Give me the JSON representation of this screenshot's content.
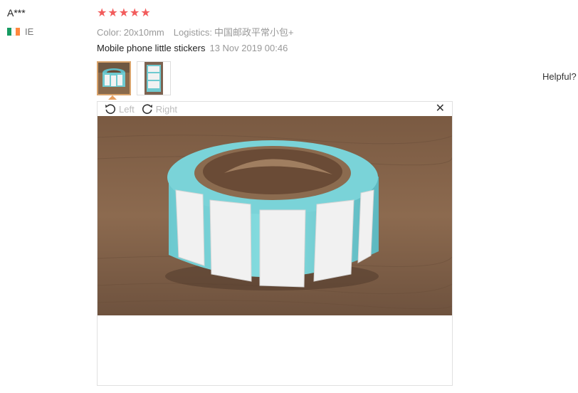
{
  "reviewer": {
    "name": "A***",
    "country": "IE",
    "flag_colors": [
      "#169b62",
      "#ffffff",
      "#ff883e"
    ]
  },
  "rating": {
    "stars": 5,
    "max": 5,
    "star_glyph": "★",
    "color": "#f25c5c"
  },
  "attributes": {
    "color_label": "Color:",
    "color_value": "20x10mm",
    "logistics_label": "Logistics:",
    "logistics_value": "中国邮政平常小包+"
  },
  "feedback": {
    "text": "Mobile phone little stickers",
    "date": "13 Nov 2019 00:46"
  },
  "viewer": {
    "left_label": "Left",
    "right_label": "Right",
    "close_glyph": "✕",
    "rotate_left_icon": "rotate-left-icon",
    "rotate_right_icon": "rotate-right-icon"
  },
  "helpful": {
    "label": "Helpful?"
  }
}
